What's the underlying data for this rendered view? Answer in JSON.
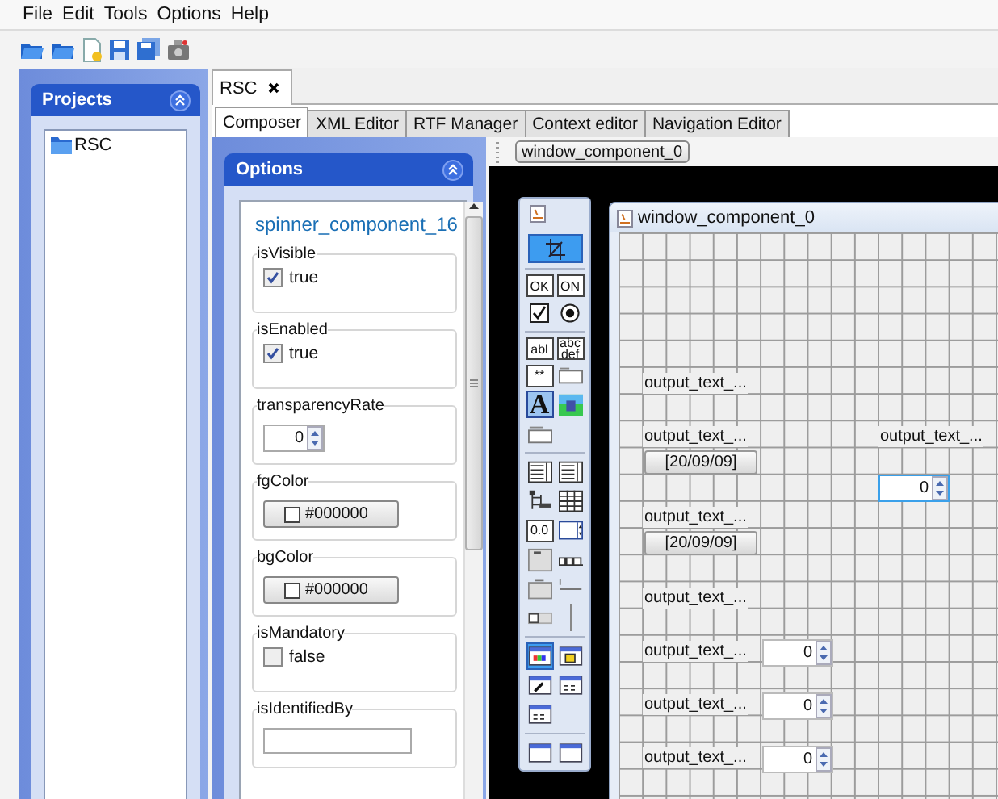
{
  "menu": [
    "File",
    "Edit",
    "Tools",
    "Options",
    "Help"
  ],
  "projects": {
    "title": "Projects",
    "items": [
      {
        "label": "RSC",
        "selected": false
      }
    ]
  },
  "document_tabs": [
    {
      "label": "RSC",
      "selected": true
    }
  ],
  "editor_tabs": [
    {
      "label": "Composer",
      "selected": true
    },
    {
      "label": "XML Editor",
      "selected": false
    },
    {
      "label": "RTF Manager",
      "selected": false
    },
    {
      "label": "Context editor",
      "selected": false
    },
    {
      "label": "Navigation Editor",
      "selected": false
    }
  ],
  "options": {
    "title": "Options",
    "component": "spinner_component_16",
    "properties": [
      {
        "kind": "checkbox",
        "label": "isVisible",
        "value": "true",
        "checked": true
      },
      {
        "kind": "checkbox",
        "label": "isEnabled",
        "value": "true",
        "checked": true
      },
      {
        "kind": "spinner",
        "label": "transparencyRate",
        "value": "0"
      },
      {
        "kind": "color",
        "label": "fgColor",
        "value": "#000000"
      },
      {
        "kind": "color",
        "label": "bgColor",
        "value": "#000000"
      },
      {
        "kind": "checkbox",
        "label": "isMandatory",
        "value": "false",
        "checked": false
      },
      {
        "kind": "text",
        "label": "isIdentifiedBy"
      }
    ]
  },
  "canvas": {
    "breadcrumb": "window_component_0",
    "palette": [
      [
        {
          "kind": "cursor",
          "selected": true
        }
      ],
      [
        {
          "kind": "toggle",
          "label": "OK",
          "selected": false
        },
        {
          "kind": "toggle",
          "label": "ON",
          "selected": false
        },
        {
          "kind": "checkbox",
          "selected": false
        },
        {
          "kind": "radio",
          "selected": false
        }
      ],
      [
        {
          "kind": "textbox",
          "label": "abl",
          "selected": false
        },
        {
          "kind": "textarea",
          "label": "abc def",
          "selected": false
        },
        {
          "kind": "password",
          "label": "**",
          "selected": false
        },
        {
          "kind": "blank",
          "selected": false
        },
        {
          "kind": "font",
          "label": "A",
          "selected": true
        },
        {
          "kind": "image",
          "selected": false
        },
        {
          "kind": "field",
          "selected": false
        }
      ],
      [
        {
          "kind": "list",
          "selected": false
        },
        {
          "kind": "list",
          "selected": false
        },
        {
          "kind": "tree",
          "selected": false
        },
        {
          "kind": "table",
          "selected": false
        },
        {
          "kind": "number",
          "label": "0.0",
          "selected": false
        },
        {
          "kind": "spinner",
          "selected": false
        },
        {
          "kind": "panel",
          "selected": false
        },
        {
          "kind": "tabs",
          "selected": false
        },
        {
          "kind": "button",
          "selected": false
        },
        {
          "kind": "separator",
          "selected": false
        },
        {
          "kind": "slider",
          "selected": false
        },
        {
          "kind": "vslider",
          "selected": false
        }
      ],
      [
        {
          "kind": "window-color",
          "selected": true
        },
        {
          "kind": "window-photo",
          "selected": false
        },
        {
          "kind": "window-pen",
          "selected": false
        },
        {
          "kind": "window-grid",
          "selected": false
        },
        {
          "kind": "window-grid",
          "selected": false
        }
      ],
      [
        {
          "kind": "window-blank",
          "selected": false
        },
        {
          "kind": "window-blank",
          "selected": false
        }
      ]
    ],
    "window": {
      "title": "window_component_0",
      "components": [
        {
          "kind": "label",
          "text": "output_text_..."
        },
        {
          "kind": "label",
          "text": "output_text_..."
        },
        {
          "kind": "label",
          "text": "output_text_..."
        },
        {
          "kind": "date",
          "text": "[20/09/09]"
        },
        {
          "kind": "spinner",
          "value": "0",
          "selected": true
        },
        {
          "kind": "label",
          "text": "output_text_..."
        },
        {
          "kind": "date",
          "text": "[20/09/09]"
        },
        {
          "kind": "label",
          "text": "output_text_..."
        },
        {
          "kind": "label",
          "text": "output_text_..."
        },
        {
          "kind": "spinner",
          "value": "0",
          "selected": false
        },
        {
          "kind": "label",
          "text": "output_text_..."
        },
        {
          "kind": "spinner",
          "value": "0",
          "selected": false
        },
        {
          "kind": "label",
          "text": "output_text_..."
        },
        {
          "kind": "spinner",
          "value": "0",
          "selected": false
        }
      ]
    }
  }
}
